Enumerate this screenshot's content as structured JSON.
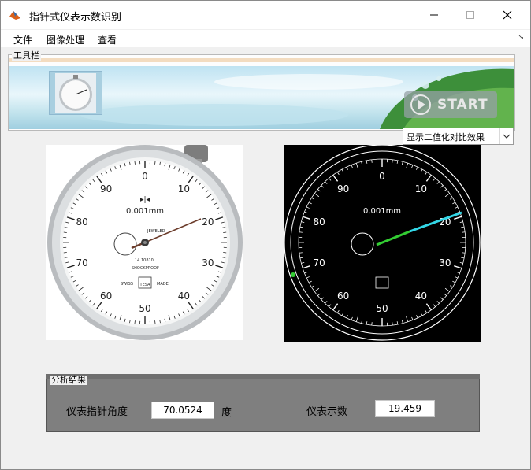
{
  "window": {
    "title": "指针式仪表示数识别"
  },
  "menu": {
    "items": [
      "文件",
      "图像处理",
      "查看"
    ]
  },
  "toolbar": {
    "label": "工具栏",
    "start_label": "START"
  },
  "mode_select": {
    "value": "显示二值化对比效果"
  },
  "gauge": {
    "dial_numbers": [
      "0",
      "10",
      "20",
      "30",
      "40",
      "50",
      "60",
      "70",
      "80",
      "90"
    ],
    "resolution": "0,001mm",
    "jewel_label": "JEWELED",
    "shockproof_label": "SHOCKPROOF",
    "swiss_label": "SWISS",
    "made_label": "MADE",
    "serial": "14.10810",
    "brand": "TESA"
  },
  "binary_image": {
    "resolution": "0,001mm"
  },
  "results": {
    "title": "分析结果",
    "angle_label": "仪表指针角度",
    "angle_value": "70.0524",
    "angle_unit": "度",
    "reading_label": "仪表示数",
    "reading_value": "19.459"
  },
  "colors": {
    "accent_orange": "#f3dcc0",
    "results_panel": "#7f7f7f",
    "needle_green": "#33cc33",
    "needle_cyan": "#33d6e6"
  }
}
